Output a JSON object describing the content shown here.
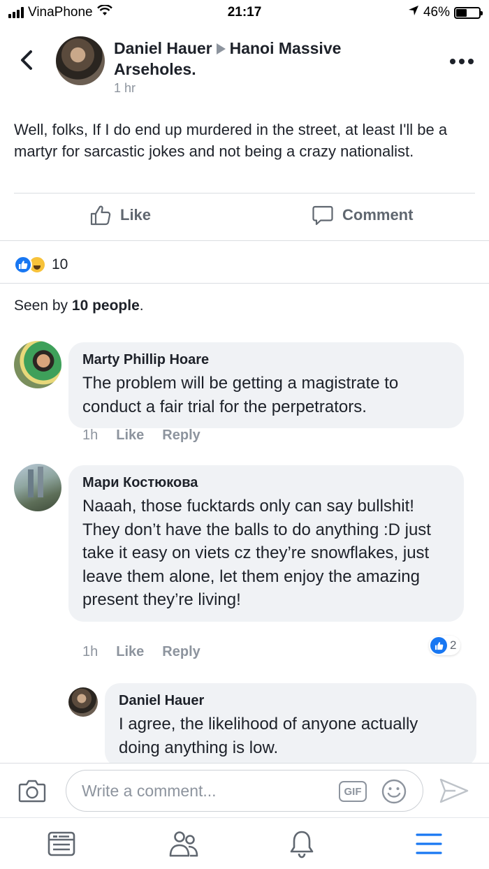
{
  "status_bar": {
    "carrier": "VinaPhone",
    "time": "21:17",
    "battery": "46%",
    "battery_level": 0.46
  },
  "post": {
    "author": "Daniel Hauer",
    "group": "Hanoi Massive Arseholes.",
    "time": "1 hr",
    "text": "Well, folks, If I do end up murdered in the street, at least I'll be a martyr for sarcastic jokes and not being a crazy nationalist.",
    "like_label": "Like",
    "comment_label": "Comment",
    "reaction_count": "10",
    "seen_prefix": "Seen by ",
    "seen_count": "10 people",
    "seen_suffix": "."
  },
  "comments": [
    {
      "author": "Marty Phillip Hoare",
      "text": "The problem will be getting a magistrate to conduct a fair trial for the perpetrators.",
      "time": "1h",
      "like_label": "Like",
      "reply_label": "Reply"
    },
    {
      "author": "Мари Костюкова",
      "text": "Naaah, those fucktards only can say bullshit! They don’t have the balls to do anything :D just take it easy on viets cz they’re snowflakes, just leave them alone, let them enjoy the amazing present they’re living!",
      "time": "1h",
      "like_label": "Like",
      "reply_label": "Reply",
      "like_count": "2"
    },
    {
      "author": "Daniel Hauer",
      "text": "I agree, the likelihood of anyone actually doing anything is low."
    }
  ],
  "composer": {
    "placeholder": "Write a comment...",
    "gif_label": "GIF"
  },
  "icons": {
    "back": "chevron-left-icon",
    "more": "more-dots-icon",
    "like": "thumbs-up-icon",
    "comment": "speech-bubble-icon",
    "camera": "camera-icon",
    "emoji": "smiley-icon",
    "send": "send-icon",
    "tabs": [
      "news-feed-icon",
      "groups-icon",
      "bell-icon",
      "menu-icon"
    ]
  },
  "colors": {
    "accent": "#1877f2",
    "active_tab": "#1877f2",
    "secondary_text": "#8d949e",
    "bubble": "#f0f2f5"
  }
}
